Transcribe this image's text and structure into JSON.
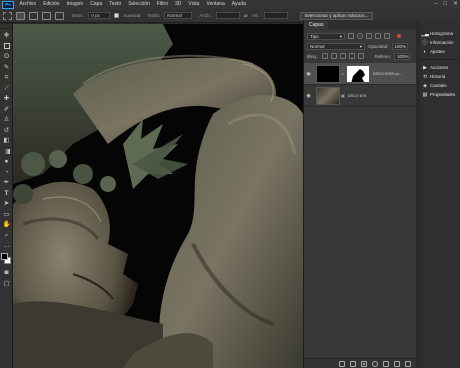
{
  "app": {
    "logo": "Ps"
  },
  "menu": [
    "Archivo",
    "Edición",
    "Imagen",
    "Capa",
    "Texto",
    "Selección",
    "Filtro",
    "3D",
    "Vista",
    "Ventana",
    "Ayuda"
  ],
  "window_controls": {
    "minimize": "–",
    "maximize": "□",
    "close": "✕"
  },
  "options_bar": {
    "feather_label": "Desv.:",
    "feather_value": "0 px",
    "antialias_label": "Suavizar",
    "style_label": "Estilo:",
    "style_value": "Normal",
    "width_label": "Anch.:",
    "height_label": "Alt.:",
    "select_mask_button": "Seleccionar y aplicar máscara..."
  },
  "tools": [
    "move-icon",
    "marquee-icon",
    "lasso-icon",
    "quick-select-icon",
    "crop-icon",
    "eyedropper-icon",
    "healing-icon",
    "brush-icon",
    "stamp-icon",
    "history-brush-icon",
    "eraser-icon",
    "gradient-icon",
    "blur-icon",
    "dodge-icon",
    "pen-icon",
    "type-icon",
    "path-select-icon",
    "shape-icon",
    "hand-icon",
    "zoom-icon",
    "more-icon"
  ],
  "colors": {
    "foreground": "#000000",
    "background": "#ffffff",
    "accent": "#31a8ff"
  },
  "layers_panel": {
    "tab": "Capas",
    "filter_kind": "Tipo",
    "blend_mode": "Normal",
    "opacity_label": "Opacidad:",
    "opacity_value": "100%",
    "lock_label": "Bloq.:",
    "fill_label": "Relleno:",
    "fill_value": "100%",
    "layers": [
      {
        "name": "DSC0 6785 co...",
        "visible": true,
        "selected": true
      },
      {
        "name": "DSC0 678",
        "visible": true,
        "selected": false
      }
    ]
  },
  "right_dock": {
    "group1": [
      {
        "icon": "histogram-icon",
        "label": "Histograma"
      },
      {
        "icon": "info-icon",
        "label": "Información"
      },
      {
        "icon": "adjustments-icon",
        "label": "Ajustes"
      }
    ],
    "group2": [
      {
        "icon": "actions-icon",
        "label": "Acciones"
      },
      {
        "icon": "history-icon",
        "label": "Historia"
      },
      {
        "icon": "channels-icon",
        "label": "Canales"
      },
      {
        "icon": "properties-icon",
        "label": "Propiedades"
      }
    ]
  }
}
